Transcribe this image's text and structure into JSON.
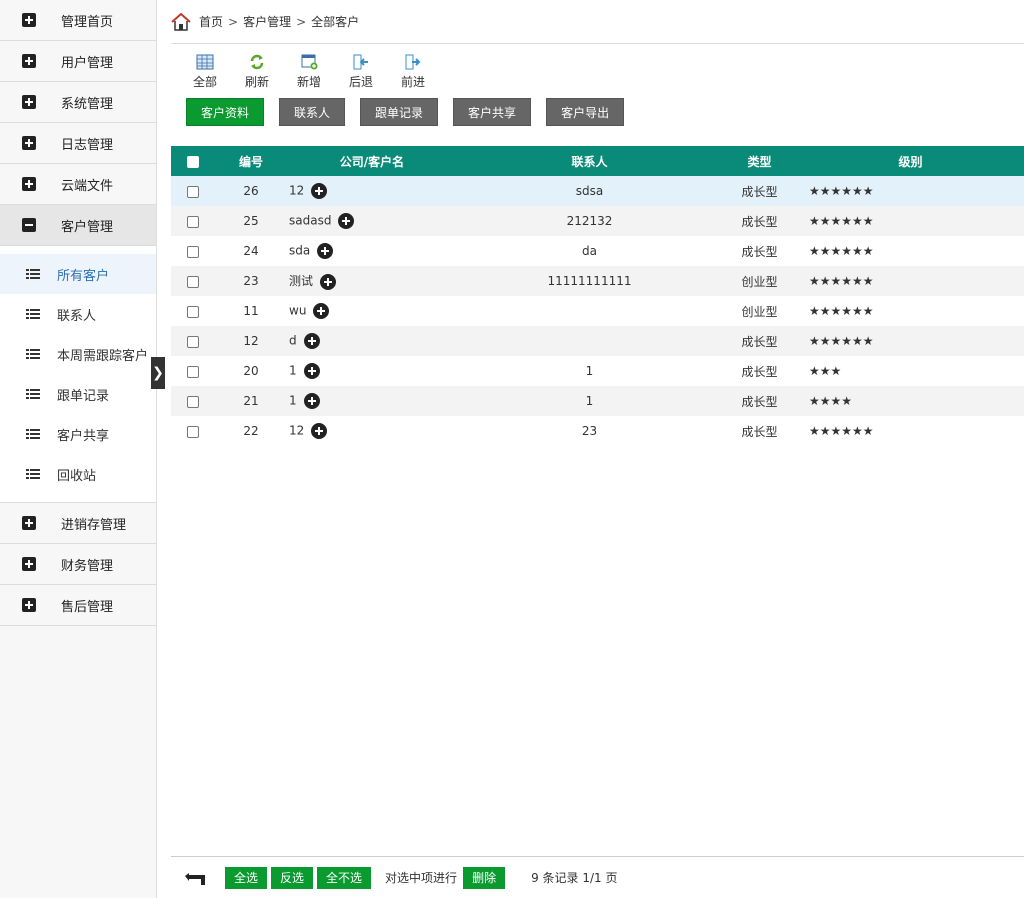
{
  "sidebar": {
    "top_items": [
      {
        "label": "管理首页"
      },
      {
        "label": "用户管理"
      },
      {
        "label": "系统管理"
      },
      {
        "label": "日志管理"
      },
      {
        "label": "云端文件"
      },
      {
        "label": "客户管理"
      }
    ],
    "sub_items": [
      {
        "label": "所有客户"
      },
      {
        "label": "联系人"
      },
      {
        "label": "本周需跟踪客户"
      },
      {
        "label": "跟单记录"
      },
      {
        "label": "客户共享"
      },
      {
        "label": "回收站"
      }
    ],
    "bottom_items": [
      {
        "label": "进销存管理"
      },
      {
        "label": "财务管理"
      },
      {
        "label": "售后管理"
      }
    ],
    "collapse_glyph": "❯"
  },
  "breadcrumb": {
    "home": "首页",
    "sep": ">",
    "level1": "客户管理",
    "level2": "全部客户"
  },
  "toolbar": {
    "all": "全部",
    "refresh": "刷新",
    "add": "新增",
    "back": "后退",
    "forward": "前进"
  },
  "tabs": [
    "客户资料",
    "联系人",
    "跟单记录",
    "客户共享",
    "客户导出"
  ],
  "table": {
    "headers": {
      "id": "编号",
      "name": "公司/客户名",
      "contact": "联系人",
      "type": "类型",
      "level": "级别"
    },
    "rows": [
      {
        "id": "26",
        "name": "12",
        "contact": "sdsa",
        "type": "成长型",
        "level": "★★★★★★"
      },
      {
        "id": "25",
        "name": "sadasd",
        "contact": "212132",
        "type": "成长型",
        "level": "★★★★★★"
      },
      {
        "id": "24",
        "name": "sda",
        "contact": "da",
        "type": "成长型",
        "level": "★★★★★★"
      },
      {
        "id": "23",
        "name": "测试",
        "contact": "11111111111",
        "type": "创业型",
        "level": "★★★★★★"
      },
      {
        "id": "11",
        "name": "wu",
        "contact": "",
        "type": "创业型",
        "level": "★★★★★★"
      },
      {
        "id": "12",
        "name": "d",
        "contact": "",
        "type": "成长型",
        "level": "★★★★★★"
      },
      {
        "id": "20",
        "name": "1",
        "contact": "1",
        "type": "成长型",
        "level": "★★★"
      },
      {
        "id": "21",
        "name": "1",
        "contact": "1",
        "type": "成长型",
        "level": "★★★★"
      },
      {
        "id": "22",
        "name": "12",
        "contact": "23",
        "type": "成长型",
        "level": "★★★★★★"
      }
    ]
  },
  "footer": {
    "select_all": "全选",
    "invert": "反选",
    "select_none": "全不选",
    "action_text": "对选中项进行",
    "delete": "删除",
    "records": "9 条记录 1/1 页"
  },
  "colors": {
    "accent_green": "#0a9a2f",
    "header_teal": "#0a8a78",
    "tab_gray": "#666666"
  }
}
